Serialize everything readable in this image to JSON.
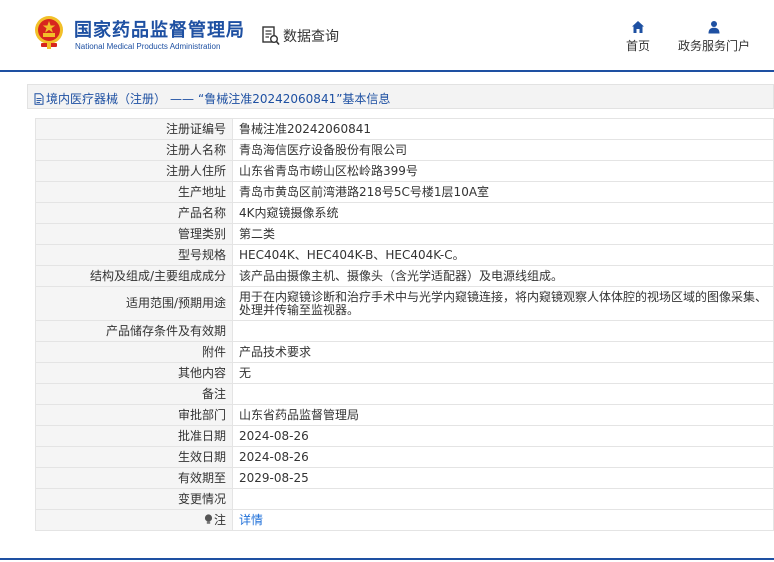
{
  "header": {
    "org_name_cn": "国家药品监督管理局",
    "org_name_en": "National Medical Products Administration",
    "query_label": "数据查询",
    "nav": {
      "home": "首页",
      "portal": "政务服务门户"
    }
  },
  "breadcrumb": {
    "category": "境内医疗器械（注册）",
    "separator": "——",
    "record": "“鲁械注准20242060841”基本信息"
  },
  "details": [
    {
      "label": "注册证编号",
      "value": "鲁械注准20242060841"
    },
    {
      "label": "注册人名称",
      "value": "青岛海信医疗设备股份有限公司"
    },
    {
      "label": "注册人住所",
      "value": "山东省青岛市崂山区松岭路399号"
    },
    {
      "label": "生产地址",
      "value": "青岛市黄岛区前湾港路218号5C号楼1层10A室"
    },
    {
      "label": "产品名称",
      "value": "4K内窥镜摄像系统"
    },
    {
      "label": "管理类别",
      "value": "第二类"
    },
    {
      "label": "型号规格",
      "value": "HEC404K、HEC404K-B、HEC404K-C。"
    },
    {
      "label": "结构及组成/主要组成成分",
      "value": "该产品由摄像主机、摄像头（含光学适配器）及电源线组成。"
    },
    {
      "label": "适用范围/预期用途",
      "value": "用于在内窥镜诊断和治疗手术中与光学内窥镜连接，将内窥镜观察人体体腔的视场区域的图像采集、处理并传输至监视器。"
    },
    {
      "label": "产品储存条件及有效期",
      "value": ""
    },
    {
      "label": "附件",
      "value": "产品技术要求"
    },
    {
      "label": "其他内容",
      "value": "无"
    },
    {
      "label": "备注",
      "value": ""
    },
    {
      "label": "审批部门",
      "value": "山东省药品监督管理局"
    },
    {
      "label": "批准日期",
      "value": "2024-08-26"
    },
    {
      "label": "生效日期",
      "value": "2024-08-26"
    },
    {
      "label": "有效期至",
      "value": "2029-08-25"
    },
    {
      "label": "变更情况",
      "value": ""
    }
  ],
  "note": {
    "label": "注",
    "link": "详情"
  },
  "colors": {
    "brand_blue": "#1e50a2",
    "link_blue": "#1e6fd8",
    "emblem_red": "#d7261e",
    "emblem_gold": "#f2c029"
  },
  "icons": {
    "emblem": "national-emblem-icon",
    "query": "data-query-icon",
    "home": "home-icon",
    "portal": "user-icon",
    "breadcrumb": "document-icon",
    "note": "bulb-icon"
  }
}
